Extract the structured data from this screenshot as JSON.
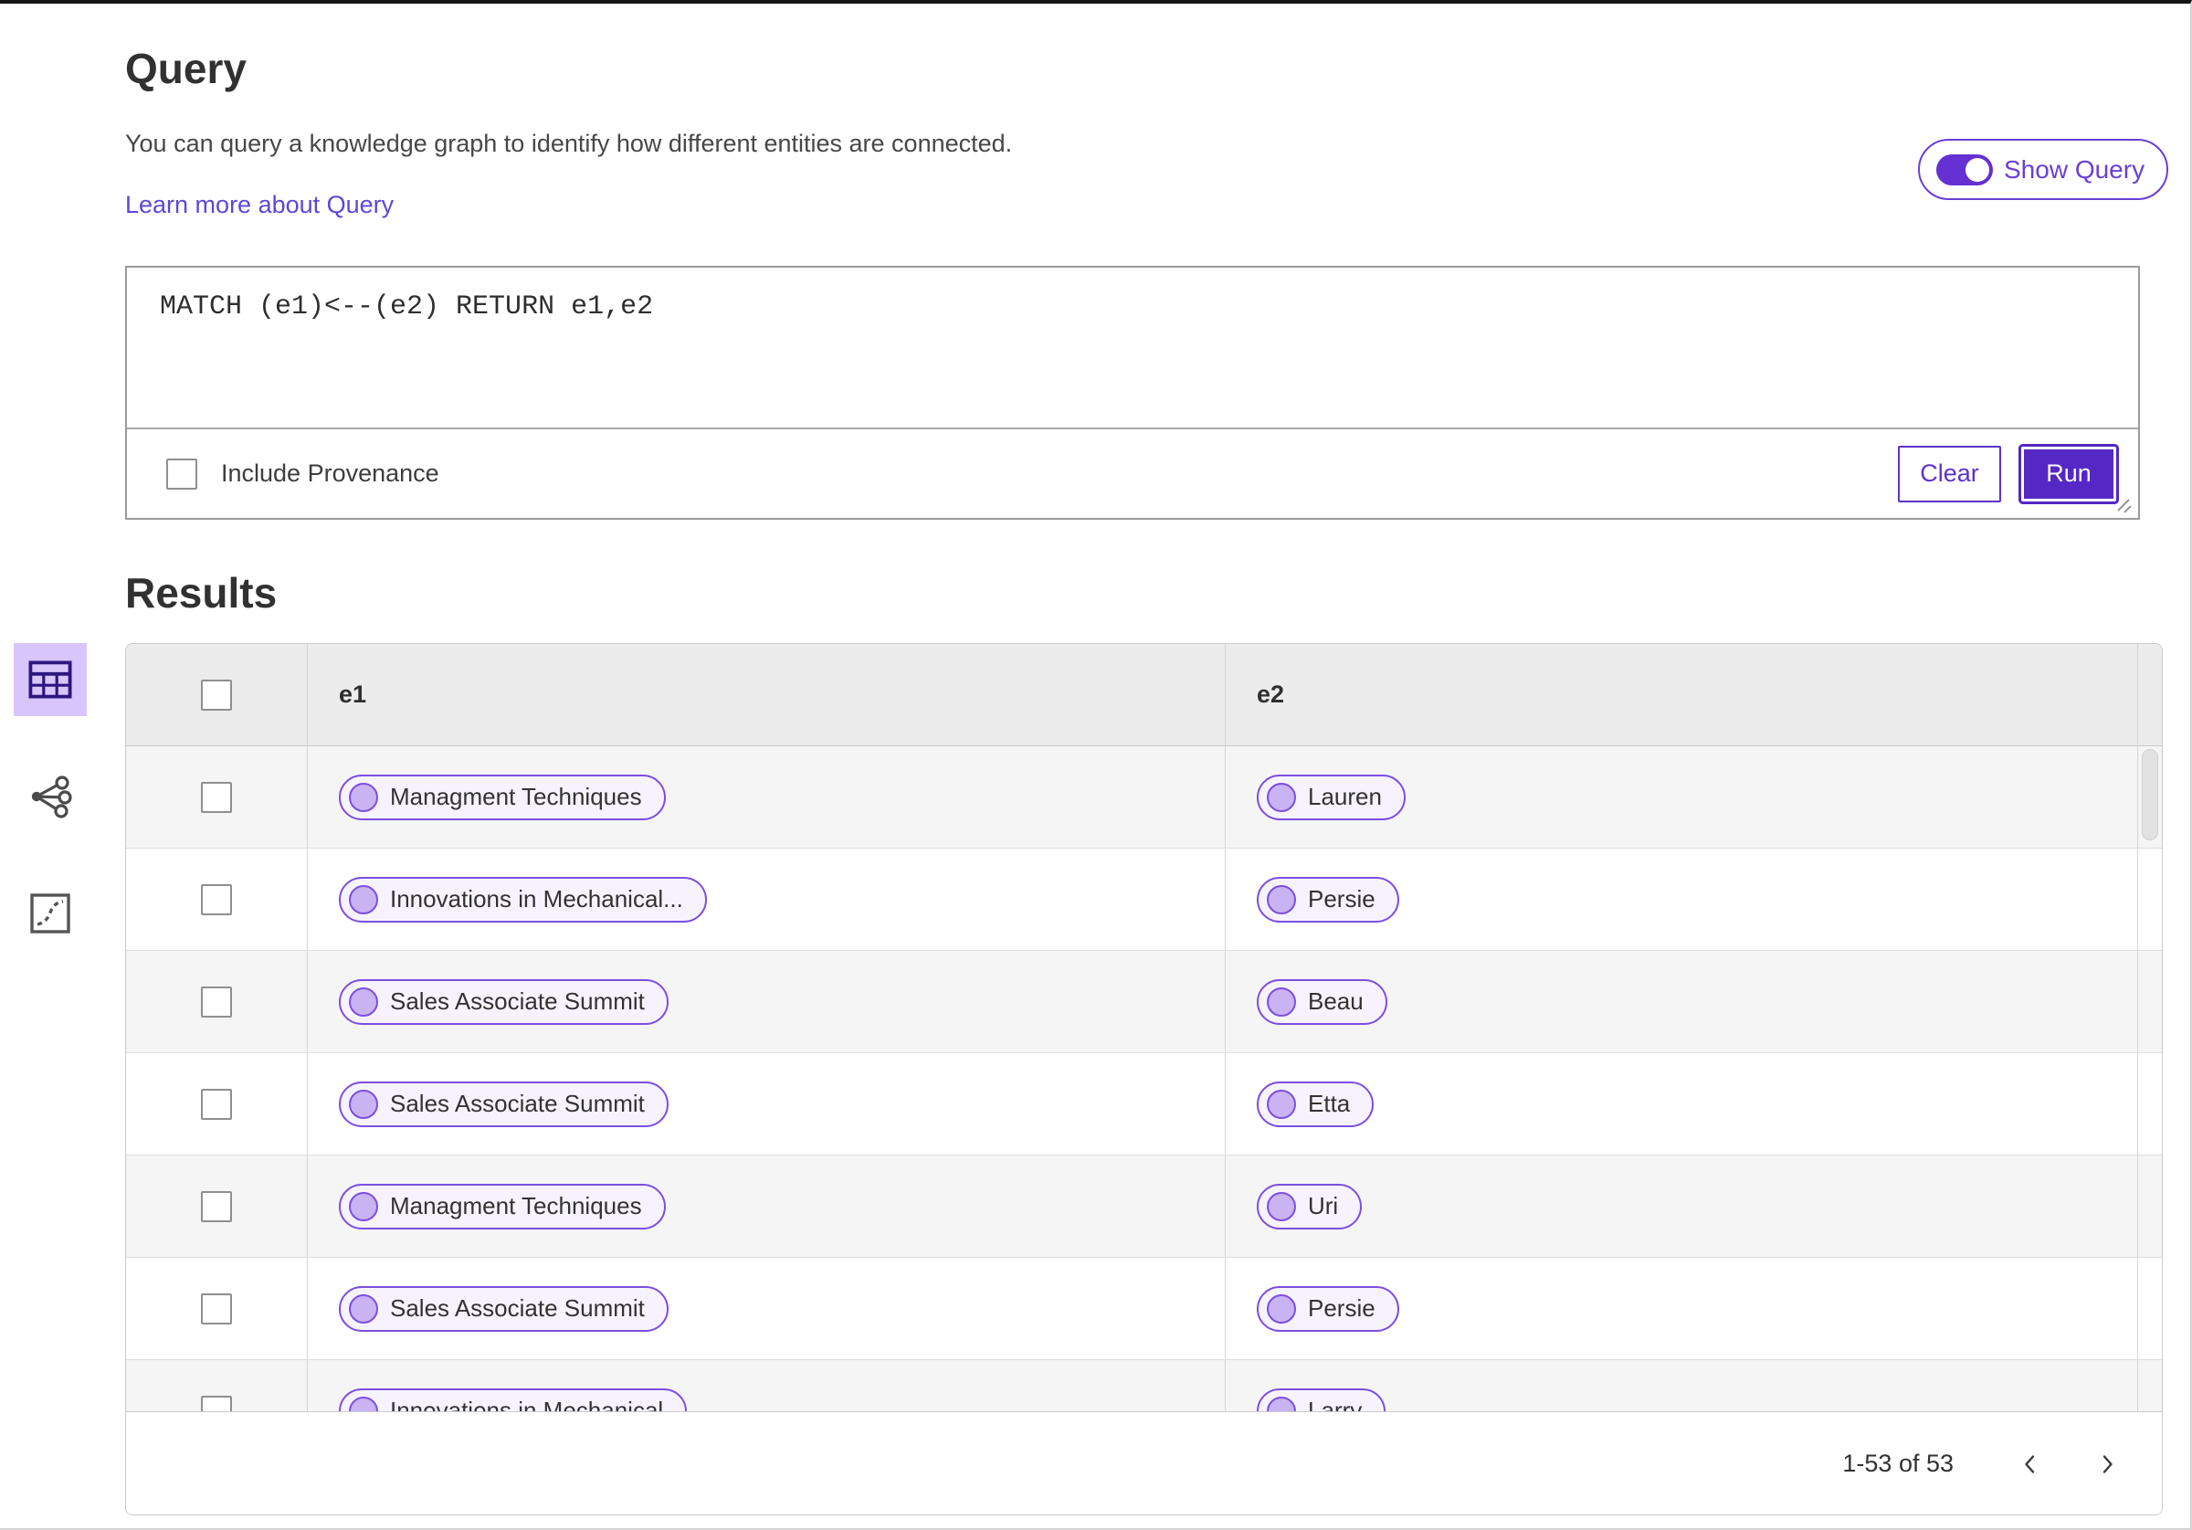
{
  "query": {
    "title": "Query",
    "description": "You can query a knowledge graph to identify how different entities are connected.",
    "learn_more": "Learn more about Query",
    "show_query": "Show Query",
    "show_query_toggle_state": "on",
    "editor_text": "MATCH (e1)<--(e2) RETURN e1,e2",
    "include_provenance": "Include Provenance",
    "include_provenance_checked": false,
    "clear": "Clear",
    "run": "Run"
  },
  "results": {
    "title": "Results",
    "columns": [
      "e1",
      "e2"
    ],
    "rows": [
      {
        "e1": "Managment Techniques",
        "e2": "Lauren"
      },
      {
        "e1": "Innovations in Mechanical...",
        "e2": "Persie"
      },
      {
        "e1": "Sales Associate Summit",
        "e2": "Beau"
      },
      {
        "e1": "Sales Associate Summit",
        "e2": "Etta"
      },
      {
        "e1": "Managment Techniques",
        "e2": "Uri"
      },
      {
        "e1": "Sales Associate Summit",
        "e2": "Persie"
      },
      {
        "e1": "Innovations in Mechanical",
        "e2": "Larry"
      }
    ],
    "pagination": {
      "range": "1-53 of 53"
    }
  },
  "icons": {
    "table-view-icon": "▦ table grid",
    "graph-view-icon": "●–○ network share",
    "chart-view-icon": "▱ dashed trend box",
    "chevron-left-icon": "‹",
    "chevron-right-icon": "›",
    "toggle-on-icon": "pill switch, knob right",
    "resize-handle-icon": "double diagonal lines",
    "checkbox-unchecked-icon": "☐"
  },
  "accents": {
    "primary_purple": "#5527c4",
    "outline_purple": "#6a3fd6",
    "pill_border": "#7b4fe0",
    "pill_fill": "#f7f3fe",
    "pill_dot": "#c9b3f3",
    "link": "#5b48d8",
    "selected_tile_bg": "#d8c5fb",
    "header_row_bg": "#ececec",
    "alt_row_bg": "#f5f5f5"
  }
}
